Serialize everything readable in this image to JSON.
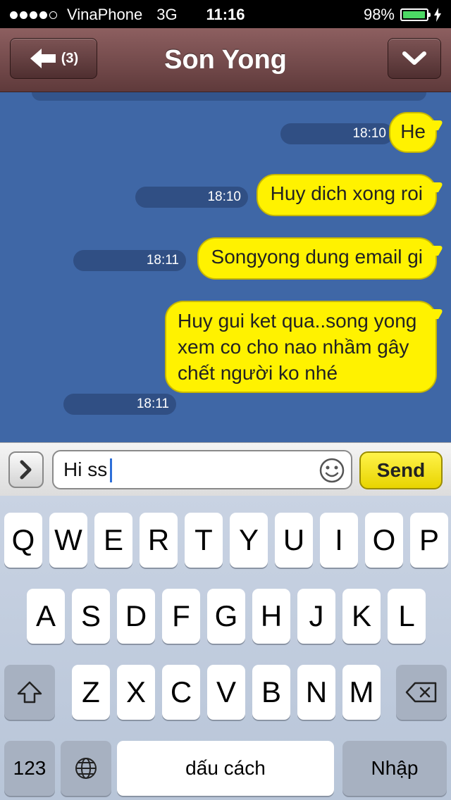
{
  "status_bar": {
    "carrier": "VinaPhone",
    "network": "3G",
    "time": "11:16",
    "battery_text": "98%",
    "battery_level": 0.98,
    "signal_bars_filled": 4,
    "signal_bars_total": 5
  },
  "nav": {
    "title": "Son Yong",
    "back_count": "(3)",
    "back_icon": "arrow-left-icon",
    "menu_icon": "chevron-down-icon"
  },
  "messages": [
    {
      "text": "He",
      "time": "18:10"
    },
    {
      "text": "Huy dich xong roi",
      "time": "18:10"
    },
    {
      "text": "Songyong dung email gi",
      "time": "18:11"
    },
    {
      "text": "Huy gui ket qua..song yong xem co cho nao nhầm gây chết người ko nhé",
      "time": "18:11"
    }
  ],
  "composer": {
    "input_value": "Hi ss",
    "send_label": "Send",
    "expand_icon": "chevron-right-icon",
    "emoji_icon": "smiley-icon"
  },
  "keyboard": {
    "row1": [
      "Q",
      "W",
      "E",
      "R",
      "T",
      "Y",
      "U",
      "I",
      "O",
      "P"
    ],
    "row2": [
      "A",
      "S",
      "D",
      "F",
      "G",
      "H",
      "J",
      "K",
      "L"
    ],
    "row3": [
      "Z",
      "X",
      "C",
      "V",
      "B",
      "N",
      "M"
    ],
    "shift_icon": "shift-icon",
    "delete_icon": "backspace-icon",
    "numbers_label": "123",
    "globe_icon": "globe-icon",
    "space_label": "dấu cách",
    "return_label": "Nhập"
  },
  "colors": {
    "nav_bar": "#7a4e4f",
    "chat_bg": "#3f67a6",
    "bubble": "#fff200",
    "send_button": "#f3e20c",
    "battery": "#4cd964"
  }
}
